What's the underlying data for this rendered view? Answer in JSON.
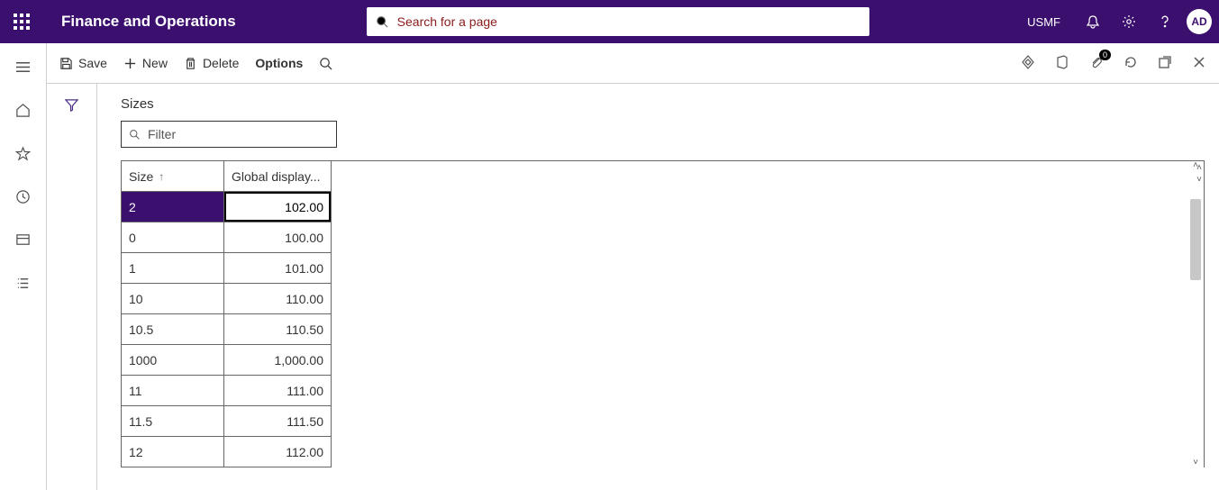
{
  "header": {
    "app_title": "Finance and Operations",
    "search_placeholder": "Search for a page",
    "entity": "USMF",
    "avatar": "AD"
  },
  "cmdbar": {
    "save": "Save",
    "new": "New",
    "delete": "Delete",
    "options": "Options",
    "attach_count": "0"
  },
  "page": {
    "title": "Sizes",
    "filter_placeholder": "Filter"
  },
  "grid": {
    "col_size": "Size",
    "col_display": "Global display...",
    "edit_value": "102.00",
    "rows": [
      {
        "size": "2",
        "display": "102.00",
        "selected": true,
        "editing": true
      },
      {
        "size": "0",
        "display": "100.00"
      },
      {
        "size": "1",
        "display": "101.00"
      },
      {
        "size": "10",
        "display": "110.00"
      },
      {
        "size": "10.5",
        "display": "110.50"
      },
      {
        "size": "1000",
        "display": "1,000.00"
      },
      {
        "size": "11",
        "display": "111.00"
      },
      {
        "size": "11.5",
        "display": "111.50"
      },
      {
        "size": "12",
        "display": "112.00"
      }
    ]
  }
}
